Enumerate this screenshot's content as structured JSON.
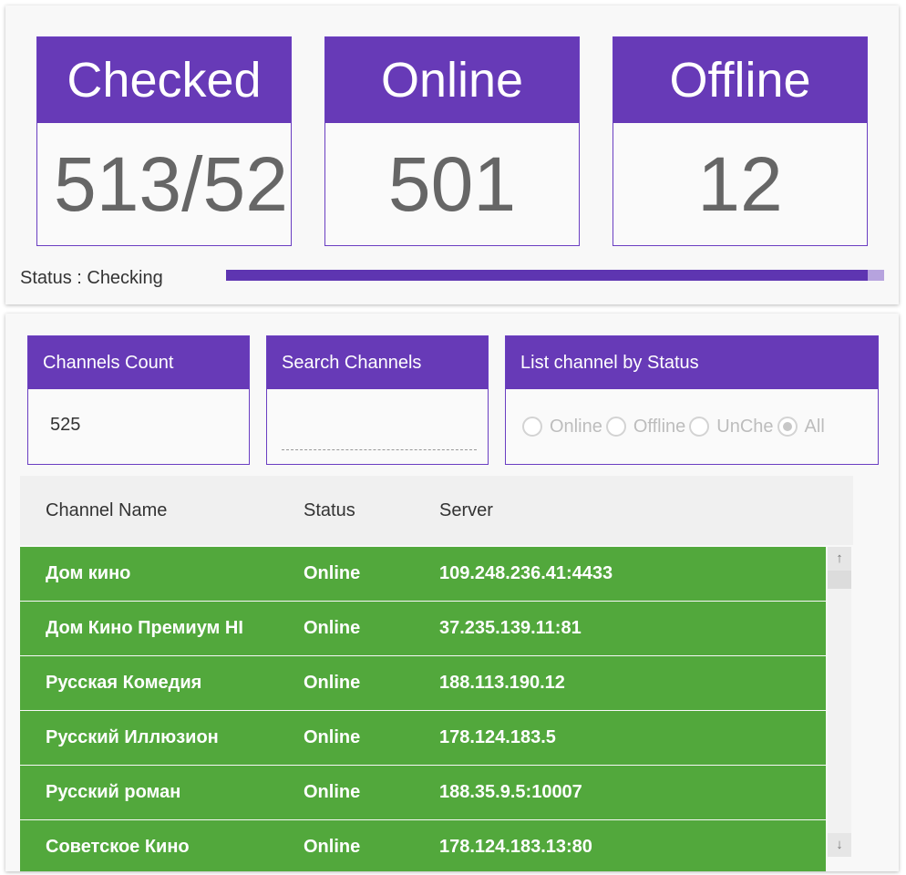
{
  "stats": {
    "checked": {
      "label": "Checked",
      "value": "513/52"
    },
    "online": {
      "label": "Online",
      "value": "501"
    },
    "offline": {
      "label": "Offline",
      "value": "12"
    }
  },
  "status": {
    "text": "Status : Checking",
    "progress_percent": 97.5
  },
  "channels_count": {
    "label": "Channels Count",
    "value": "525"
  },
  "search": {
    "label": "Search Channels",
    "value": "",
    "placeholder": ""
  },
  "filter": {
    "label": "List channel by Status",
    "options": [
      {
        "label": "Online",
        "checked": false
      },
      {
        "label": "Offline",
        "checked": false
      },
      {
        "label": "UnChe",
        "checked": false
      },
      {
        "label": "All",
        "checked": true
      }
    ]
  },
  "table": {
    "columns": [
      "Channel Name",
      "Status",
      "Server"
    ],
    "rows": [
      [
        "Дом кино",
        "Online",
        "109.248.236.41:4433"
      ],
      [
        "Дом Кино Премиум HI",
        "Online",
        "37.235.139.11:81"
      ],
      [
        "Русская Комедия",
        "Online",
        "188.113.190.12"
      ],
      [
        "Русский Иллюзион",
        "Online",
        "178.124.183.5"
      ],
      [
        "Русский роман",
        "Online",
        "188.35.9.5:10007"
      ],
      [
        "Советское Кино",
        "Online",
        "178.124.183.13:80"
      ]
    ],
    "row_color": "#52a83c"
  },
  "scrollbar": {
    "up_icon": "arrow-up-icon",
    "down_icon": "arrow-down-icon"
  },
  "colors": {
    "accent": "#673ab7",
    "online_row": "#52a83c"
  }
}
